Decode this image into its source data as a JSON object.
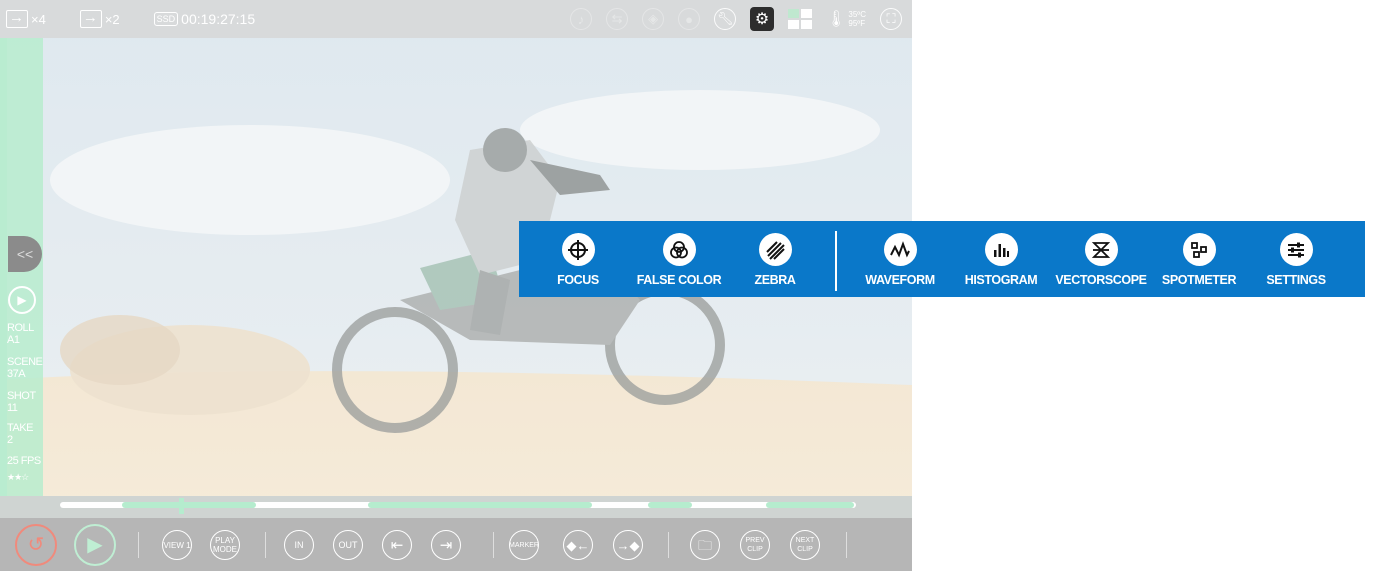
{
  "topbar": {
    "out1_count": "×4",
    "out2_count": "×2",
    "media_label": "SSD",
    "timecode": "00:19:27:15",
    "temp_c": "35ºC",
    "temp_f": "95ºF"
  },
  "left_panel": {
    "collapse_glyph": "<<",
    "metadata": [
      {
        "label": "ROLL",
        "value": "A1"
      },
      {
        "label": "SCENE",
        "value": "37A"
      },
      {
        "label": "SHOT",
        "value": "11"
      },
      {
        "label": "TAKE",
        "value": "2"
      }
    ],
    "fps": "25 FPS",
    "rating": 2,
    "rating_max": 3
  },
  "controls": {
    "view": "VIEW 1",
    "play_mode": "PLAY MODE",
    "in": "IN",
    "out": "OUT",
    "marker": "MARKER",
    "prev_clip": "PREV CLIP",
    "next_clip": "NEXT CLIP"
  },
  "toolbar": {
    "focus": "FOCUS",
    "false_color": "FALSE COLOR",
    "zebra": "ZEBRA",
    "waveform": "WAVEFORM",
    "histogram": "HISTOGRAM",
    "vectorscope": "VECTORSCOPE",
    "spotmeter": "SPOTMETER",
    "settings": "SETTINGS"
  },
  "colors": {
    "toolbar_blue": "#0a78c9",
    "accent_green": "#b5ecce",
    "record_red": "#f08a7c"
  }
}
